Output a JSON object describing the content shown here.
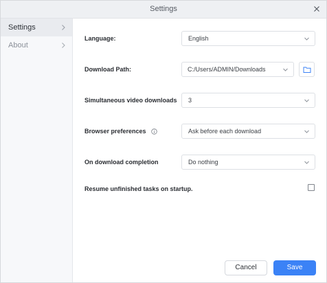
{
  "window": {
    "title": "Settings"
  },
  "sidebar": {
    "items": [
      {
        "label": "Settings",
        "active": true
      },
      {
        "label": "About",
        "active": false
      }
    ]
  },
  "settings": {
    "language": {
      "label": "Language:",
      "value": "English"
    },
    "download_path": {
      "label": "Download Path:",
      "value": "C:/Users/ADMIN/Downloads"
    },
    "simultaneous": {
      "label": "Simultaneous video downloads",
      "value": "3"
    },
    "browser_prefs": {
      "label": "Browser preferences",
      "value": "Ask before each download"
    },
    "on_completion": {
      "label": "On download completion",
      "value": "Do nothing"
    },
    "resume": {
      "label": "Resume unfinished tasks on startup.",
      "checked": false
    }
  },
  "footer": {
    "cancel_label": "Cancel",
    "save_label": "Save"
  },
  "colors": {
    "accent": "#3b82f6",
    "sidebar_bg": "#f7f8fa",
    "titlebar_bg": "#eef0f3"
  }
}
